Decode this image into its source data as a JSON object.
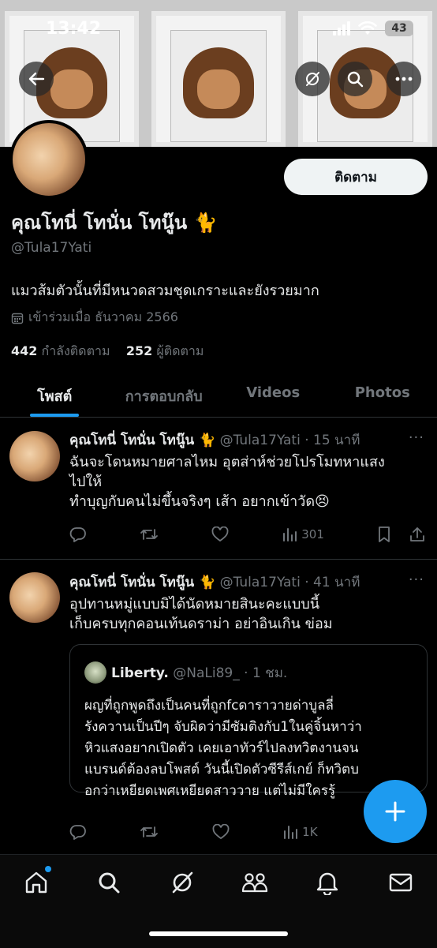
{
  "status_bar": {
    "time": "13:42",
    "battery": "43"
  },
  "profile": {
    "follow_label": "ติดตาม",
    "display_name": "คุณโทนี่ โทนั่น โทนู๊น 🐈",
    "handle": "@Tula17Yati",
    "bio": "แมวส้มตัวนั้นที่มีหนวดสวมชุดเกราะและยังรวยมาก",
    "joined": "เข้าร่วมเมื่อ ธันวาคม 2566",
    "following_count": "442",
    "following_label": "กำลังติดตาม",
    "followers_count": "252",
    "followers_label": "ผู้ติดตาม"
  },
  "tabs": [
    {
      "label": "โพสต์",
      "active": true
    },
    {
      "label": "การตอบกลับ",
      "active": false
    },
    {
      "label": "Videos",
      "active": false
    },
    {
      "label": "Photos",
      "active": false
    }
  ],
  "posts": [
    {
      "name": "คุณโทนี่ โทนั่น โทนู๊น 🐈",
      "handle": "@Tula17Yati",
      "time": "· 15 นาที",
      "text": "ฉันจะโดนหมายศาลไหม อุตส่าห์ช่วยโปรโมทหาแสง\nไปให้\nทำบุญกับคนไม่ขึ้นจริงๆ เส้า อยากเข้าวัด😣",
      "views": "301"
    },
    {
      "name": "คุณโทนี่ โทนั่น โทนู๊น 🐈",
      "handle": "@Tula17Yati",
      "time": "· 41 นาที",
      "text": "อุปทานหมู่แบบมิได้นัดหมายสินะคะแบบนี้\nเก็บครบทุกคอนเท้นดราม่า อย่าอินเกิน ข่อม",
      "views": "1K",
      "quote": {
        "name": "Liberty.",
        "handle": "@NaLi89_",
        "time": "· 1 ชม.",
        "text": "ผญที่ถูกพูดถึงเป็นคนที่ถูกfcดาราวายด่าบูลลี่\nรังควานเป็นปีๆ จับผิดว่ามีซัมติงกับ1ในคู่จิ้นหาว่า\nหิวแสงอยากเปิดตัว เคยเอาทัวร์ไปลงทวิตงานจน\nแบรนด์ต้องลบโพสต์ วันนี้เปิดตัวซีรีส์เกย์ ก็ทวิตบ\nอกว่าเหยียดเพศเหยียดสาววาย แต่ไม่มีใครรู้"
      }
    }
  ],
  "colors": {
    "accent": "#1d9bf0",
    "background": "#000000",
    "muted": "#71767b"
  }
}
